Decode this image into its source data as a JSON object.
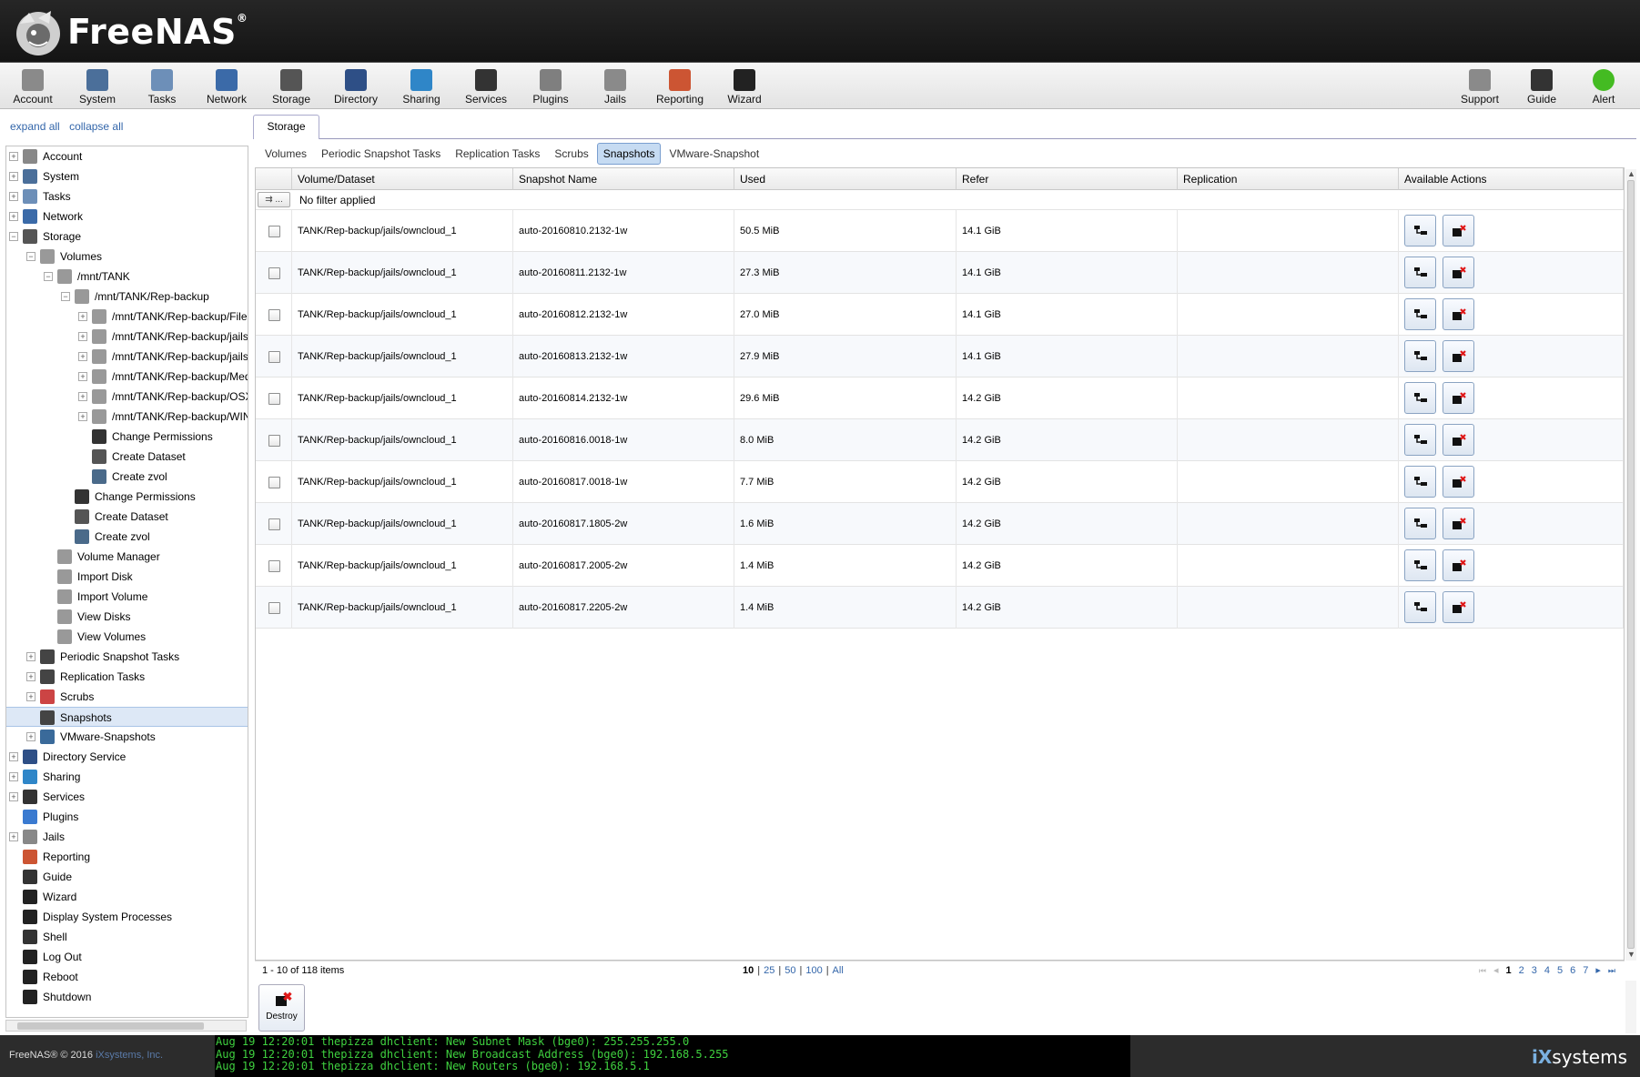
{
  "brand": {
    "name": "FreeNAS",
    "reg": "®"
  },
  "toolbar": [
    {
      "label": "Account",
      "icon": "account-icon",
      "color": "#8a8a8a"
    },
    {
      "label": "System",
      "icon": "system-icon",
      "color": "#4b6f9a"
    },
    {
      "label": "Tasks",
      "icon": "tasks-icon",
      "color": "#6d8fb8"
    },
    {
      "label": "Network",
      "icon": "network-icon",
      "color": "#3b6aa8"
    },
    {
      "label": "Storage",
      "icon": "storage-icon",
      "color": "#555555"
    },
    {
      "label": "Directory",
      "icon": "directory-icon",
      "color": "#2e4f86"
    },
    {
      "label": "Sharing",
      "icon": "sharing-icon",
      "color": "#2f86c8"
    },
    {
      "label": "Services",
      "icon": "services-icon",
      "color": "#333333"
    },
    {
      "label": "Plugins",
      "icon": "plugins-icon",
      "color": "#7f7f7f"
    },
    {
      "label": "Jails",
      "icon": "jails-icon",
      "color": "#8a8a8a"
    },
    {
      "label": "Reporting",
      "icon": "reporting-icon",
      "color": "#cc5533"
    },
    {
      "label": "Wizard",
      "icon": "wizard-icon",
      "color": "#222222"
    }
  ],
  "toolbar_right": [
    {
      "label": "Support",
      "icon": "support-icon",
      "color": "#8a8a8a"
    },
    {
      "label": "Guide",
      "icon": "guide-icon",
      "color": "#333333"
    },
    {
      "label": "Alert",
      "icon": "alert-icon",
      "color": "#44bb22"
    }
  ],
  "sidebar": {
    "expand_all": "expand all",
    "collapse_all": "collapse all",
    "tree": [
      {
        "label": "Account",
        "level": 0,
        "pm": "+",
        "icon": "account-icon",
        "color": "#888"
      },
      {
        "label": "System",
        "level": 0,
        "pm": "+",
        "icon": "system-icon",
        "color": "#4b6f9a"
      },
      {
        "label": "Tasks",
        "level": 0,
        "pm": "+",
        "icon": "tasks-icon",
        "color": "#6d8fb8"
      },
      {
        "label": "Network",
        "level": 0,
        "pm": "+",
        "icon": "network-icon",
        "color": "#3b6aa8"
      },
      {
        "label": "Storage",
        "level": 0,
        "pm": "-",
        "icon": "storage-icon",
        "color": "#555"
      },
      {
        "label": "Volumes",
        "level": 1,
        "pm": "-",
        "icon": "volumes-icon",
        "color": "#999"
      },
      {
        "label": "/mnt/TANK",
        "level": 2,
        "pm": "-",
        "icon": "volume-icon",
        "color": "#999"
      },
      {
        "label": "/mnt/TANK/Rep-backup",
        "level": 3,
        "pm": "-",
        "icon": "dataset-icon",
        "color": "#999"
      },
      {
        "label": "/mnt/TANK/Rep-backup/File-Sl",
        "level": 4,
        "pm": "+",
        "icon": "dataset-icon",
        "color": "#999"
      },
      {
        "label": "/mnt/TANK/Rep-backup/jails",
        "level": 4,
        "pm": "+",
        "icon": "dataset-icon",
        "color": "#999"
      },
      {
        "label": "/mnt/TANK/Rep-backup/jails/ov",
        "level": 4,
        "pm": "+",
        "icon": "dataset-icon",
        "color": "#999"
      },
      {
        "label": "/mnt/TANK/Rep-backup/Media",
        "level": 4,
        "pm": "+",
        "icon": "dataset-icon",
        "color": "#999"
      },
      {
        "label": "/mnt/TANK/Rep-backup/OSX-E",
        "level": 4,
        "pm": "+",
        "icon": "dataset-icon",
        "color": "#999"
      },
      {
        "label": "/mnt/TANK/Rep-backup/WIN-B",
        "level": 4,
        "pm": "+",
        "icon": "dataset-icon",
        "color": "#999"
      },
      {
        "label": "Change Permissions",
        "level": 4,
        "pm": "",
        "icon": "key-icon",
        "color": "#333"
      },
      {
        "label": "Create Dataset",
        "level": 4,
        "pm": "",
        "icon": "create-dataset-icon",
        "color": "#555"
      },
      {
        "label": "Create zvol",
        "level": 4,
        "pm": "",
        "icon": "create-zvol-icon",
        "color": "#4a6a8a"
      },
      {
        "label": "Change Permissions",
        "level": 3,
        "pm": "",
        "icon": "key-icon",
        "color": "#333"
      },
      {
        "label": "Create Dataset",
        "level": 3,
        "pm": "",
        "icon": "create-dataset-icon",
        "color": "#555"
      },
      {
        "label": "Create zvol",
        "level": 3,
        "pm": "",
        "icon": "create-zvol-icon",
        "color": "#4a6a8a"
      },
      {
        "label": "Volume Manager",
        "level": 2,
        "pm": "",
        "icon": "volume-manager-icon",
        "color": "#999"
      },
      {
        "label": "Import Disk",
        "level": 2,
        "pm": "",
        "icon": "import-disk-icon",
        "color": "#999"
      },
      {
        "label": "Import Volume",
        "level": 2,
        "pm": "",
        "icon": "import-volume-icon",
        "color": "#999"
      },
      {
        "label": "View Disks",
        "level": 2,
        "pm": "",
        "icon": "view-disks-icon",
        "color": "#999"
      },
      {
        "label": "View Volumes",
        "level": 2,
        "pm": "",
        "icon": "view-volumes-icon",
        "color": "#999"
      },
      {
        "label": "Periodic Snapshot Tasks",
        "level": 1,
        "pm": "+",
        "icon": "periodic-snapshot-icon",
        "color": "#444"
      },
      {
        "label": "Replication Tasks",
        "level": 1,
        "pm": "+",
        "icon": "replication-icon",
        "color": "#444"
      },
      {
        "label": "Scrubs",
        "level": 1,
        "pm": "+",
        "icon": "scrubs-icon",
        "color": "#c44"
      },
      {
        "label": "Snapshots",
        "level": 1,
        "pm": "",
        "icon": "snapshots-icon",
        "color": "#444",
        "selected": true
      },
      {
        "label": "VMware-Snapshots",
        "level": 1,
        "pm": "+",
        "icon": "vmware-icon",
        "color": "#3a6a9a"
      },
      {
        "label": "Directory Service",
        "level": 0,
        "pm": "+",
        "icon": "directory-icon",
        "color": "#2e4f86"
      },
      {
        "label": "Sharing",
        "level": 0,
        "pm": "+",
        "icon": "sharing-icon",
        "color": "#2f86c8"
      },
      {
        "label": "Services",
        "level": 0,
        "pm": "+",
        "icon": "services-icon",
        "color": "#333"
      },
      {
        "label": "Plugins",
        "level": 0,
        "pm": "",
        "icon": "plugins-icon",
        "color": "#3a7ad0"
      },
      {
        "label": "Jails",
        "level": 0,
        "pm": "+",
        "icon": "jails-icon",
        "color": "#888"
      },
      {
        "label": "Reporting",
        "level": 0,
        "pm": "",
        "icon": "reporting-icon",
        "color": "#c53"
      },
      {
        "label": "Guide",
        "level": 0,
        "pm": "",
        "icon": "guide-icon",
        "color": "#333"
      },
      {
        "label": "Wizard",
        "level": 0,
        "pm": "",
        "icon": "wizard-icon",
        "color": "#222"
      },
      {
        "label": "Display System Processes",
        "level": 0,
        "pm": "",
        "icon": "processes-icon",
        "color": "#222"
      },
      {
        "label": "Shell",
        "level": 0,
        "pm": "",
        "icon": "shell-icon",
        "color": "#333"
      },
      {
        "label": "Log Out",
        "level": 0,
        "pm": "",
        "icon": "logout-icon",
        "color": "#222"
      },
      {
        "label": "Reboot",
        "level": 0,
        "pm": "",
        "icon": "reboot-icon",
        "color": "#222"
      },
      {
        "label": "Shutdown",
        "level": 0,
        "pm": "",
        "icon": "shutdown-icon",
        "color": "#222"
      }
    ]
  },
  "main": {
    "tab": "Storage",
    "subtabs": [
      {
        "label": "Volumes",
        "active": false
      },
      {
        "label": "Periodic Snapshot Tasks",
        "active": false
      },
      {
        "label": "Replication Tasks",
        "active": false
      },
      {
        "label": "Scrubs",
        "active": false
      },
      {
        "label": "Snapshots",
        "active": true
      },
      {
        "label": "VMware-Snapshot",
        "active": false
      }
    ],
    "columns": [
      "Volume/Dataset",
      "Snapshot Name",
      "Used",
      "Refer",
      "Replication",
      "Available Actions"
    ],
    "filter_button": "...",
    "filter_text": "No filter applied",
    "rows": [
      {
        "dataset": "TANK/Rep-backup/jails/owncloud_1",
        "snapshot": "auto-20160810.2132-1w",
        "used": "50.5 MiB",
        "refer": "14.1 GiB",
        "replication": ""
      },
      {
        "dataset": "TANK/Rep-backup/jails/owncloud_1",
        "snapshot": "auto-20160811.2132-1w",
        "used": "27.3 MiB",
        "refer": "14.1 GiB",
        "replication": ""
      },
      {
        "dataset": "TANK/Rep-backup/jails/owncloud_1",
        "snapshot": "auto-20160812.2132-1w",
        "used": "27.0 MiB",
        "refer": "14.1 GiB",
        "replication": ""
      },
      {
        "dataset": "TANK/Rep-backup/jails/owncloud_1",
        "snapshot": "auto-20160813.2132-1w",
        "used": "27.9 MiB",
        "refer": "14.1 GiB",
        "replication": ""
      },
      {
        "dataset": "TANK/Rep-backup/jails/owncloud_1",
        "snapshot": "auto-20160814.2132-1w",
        "used": "29.6 MiB",
        "refer": "14.2 GiB",
        "replication": ""
      },
      {
        "dataset": "TANK/Rep-backup/jails/owncloud_1",
        "snapshot": "auto-20160816.0018-1w",
        "used": "8.0 MiB",
        "refer": "14.2 GiB",
        "replication": ""
      },
      {
        "dataset": "TANK/Rep-backup/jails/owncloud_1",
        "snapshot": "auto-20160817.0018-1w",
        "used": "7.7 MiB",
        "refer": "14.2 GiB",
        "replication": ""
      },
      {
        "dataset": "TANK/Rep-backup/jails/owncloud_1",
        "snapshot": "auto-20160817.1805-2w",
        "used": "1.6 MiB",
        "refer": "14.2 GiB",
        "replication": ""
      },
      {
        "dataset": "TANK/Rep-backup/jails/owncloud_1",
        "snapshot": "auto-20160817.2005-2w",
        "used": "1.4 MiB",
        "refer": "14.2 GiB",
        "replication": ""
      },
      {
        "dataset": "TANK/Rep-backup/jails/owncloud_1",
        "snapshot": "auto-20160817.2205-2w",
        "used": "1.4 MiB",
        "refer": "14.2 GiB",
        "replication": ""
      }
    ],
    "items_text": "1 - 10 of 118 items",
    "page_sizes": [
      "10",
      "25",
      "50",
      "100",
      "All"
    ],
    "current_page_size": "10",
    "pages": [
      "1",
      "2",
      "3",
      "4",
      "5",
      "6",
      "7"
    ],
    "current_page": "1",
    "destroy_label": "Destroy"
  },
  "footer": {
    "copyright": "FreeNAS® © 2016",
    "company": "iXsystems, Inc.",
    "console": [
      "Aug 19 12:20:01 thepizza dhclient: New Subnet Mask (bge0): 255.255.255.0",
      "Aug 19 12:20:01 thepizza dhclient: New Broadcast Address (bge0): 192.168.5.255",
      "Aug 19 12:20:01 thepizza dhclient: New Routers (bge0): 192.168.5.1"
    ],
    "ix_logo_a": "iX",
    "ix_logo_b": "systems"
  }
}
